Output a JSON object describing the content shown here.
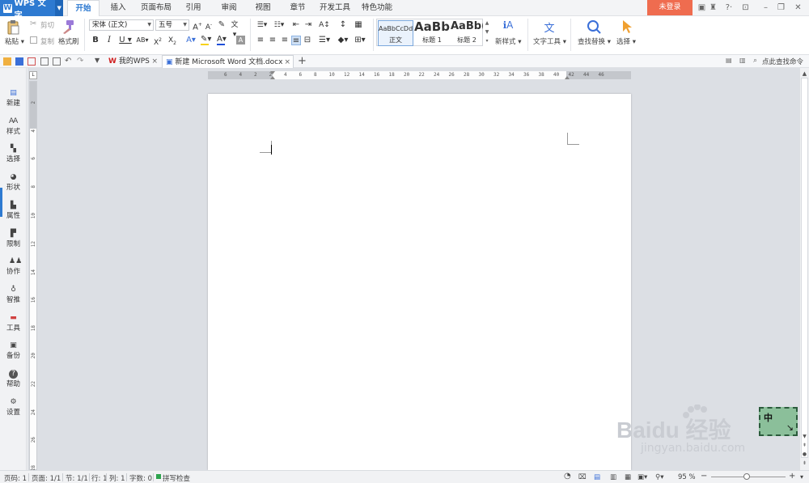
{
  "app": {
    "name": "WPS 文字",
    "login_label": "未登录"
  },
  "menu_tabs": [
    "开始",
    "插入",
    "页面布局",
    "引用",
    "审阅",
    "视图",
    "章节",
    "开发工具",
    "特色功能"
  ],
  "ribbon": {
    "paste": "粘贴",
    "cut": "剪切",
    "copy": "复制",
    "format_painter": "格式刷",
    "font_name": "宋体 (正文)",
    "font_size": "五号",
    "styles": [
      {
        "preview": "AaBbCcDd",
        "name": "正文"
      },
      {
        "preview": "AaBb",
        "name": "标题 1"
      },
      {
        "preview": "AaBb(",
        "name": "标题 2"
      }
    ],
    "new_style": "新样式",
    "text_tools": "文字工具",
    "find_replace": "查找替换",
    "select": "选择"
  },
  "quick_bar": {
    "tabs": [
      {
        "label": "我的WPS"
      },
      {
        "label": "新建 Microsoft Word 文档.docx"
      }
    ],
    "command_search": "点此查找命令"
  },
  "ruler": {
    "h_labels": [
      "6",
      "4",
      "2",
      "2",
      "4",
      "6",
      "8",
      "10",
      "12",
      "14",
      "16",
      "18",
      "20",
      "22",
      "24",
      "26",
      "28",
      "30",
      "32",
      "34",
      "36",
      "38",
      "40",
      "42",
      "44",
      "46"
    ],
    "v_labels": [
      "2",
      "4",
      "6",
      "8",
      "10",
      "12",
      "14",
      "16",
      "18",
      "20",
      "22",
      "24",
      "26",
      "28"
    ]
  },
  "sidebar": {
    "items": [
      {
        "label": "新建",
        "icon": "new-doc-icon"
      },
      {
        "label": "样式",
        "icon": "style-icon"
      },
      {
        "label": "选择",
        "icon": "select-icon"
      },
      {
        "label": "形状",
        "icon": "shape-icon"
      },
      {
        "label": "属性",
        "icon": "properties-icon"
      },
      {
        "label": "限制",
        "icon": "restrict-icon"
      },
      {
        "label": "协作",
        "icon": "collaborate-icon"
      },
      {
        "label": "智推",
        "icon": "smart-push-icon"
      },
      {
        "label": "工具",
        "icon": "toolbox-icon"
      },
      {
        "label": "备份",
        "icon": "backup-icon"
      },
      {
        "label": "帮助",
        "icon": "help-icon"
      },
      {
        "label": "设置",
        "icon": "settings-icon"
      }
    ]
  },
  "status": {
    "page": "页码: 1",
    "pages": "页面: 1/1",
    "section": "节: 1/1",
    "row": "行: 1",
    "col": "列: 1",
    "words": "字数: 0",
    "spell": "拼写检查",
    "zoom": "95 %"
  },
  "ime": {
    "label": "中"
  },
  "watermark": {
    "brand": "Baidu 经验",
    "url": "jingyan.baidu.com"
  },
  "colors": {
    "accent": "#2e7ad1",
    "login": "#ef6c4f",
    "font_color": "#1f4fd8",
    "highlight": "#f7d21a"
  }
}
